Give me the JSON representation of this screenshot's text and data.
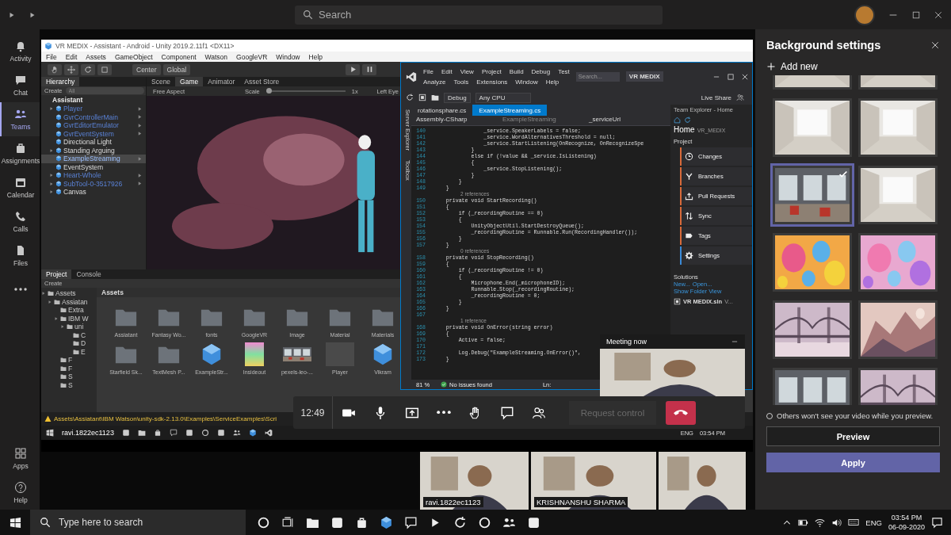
{
  "title_bar": {
    "search_placeholder": "Search"
  },
  "rail": [
    {
      "label": "Activity",
      "kind": "bell",
      "selected": false
    },
    {
      "label": "Chat",
      "kind": "chat",
      "selected": false
    },
    {
      "label": "Teams",
      "kind": "teams",
      "selected": true
    },
    {
      "label": "Assignments",
      "kind": "bag",
      "selected": false
    },
    {
      "label": "Calendar",
      "kind": "calendar",
      "selected": false
    },
    {
      "label": "Calls",
      "kind": "phone",
      "selected": false
    },
    {
      "label": "Files",
      "kind": "file",
      "selected": false
    },
    {
      "kind": "more",
      "selected": false
    }
  ],
  "rail_bottom": [
    {
      "label": "Apps",
      "kind": "apps"
    },
    {
      "label": "Help",
      "kind": "help"
    }
  ],
  "shared_screen": {
    "unity": {
      "title": "VR MEDIX - Assistant - Android - Unity 2019.2.11f1 <DX11>",
      "menu": [
        "File",
        "Edit",
        "Assets",
        "GameObject",
        "Component",
        "Watson",
        "GoogleVR",
        "Window",
        "Help"
      ],
      "pivot": [
        "Center",
        "Global"
      ],
      "hierarchy": {
        "tab": "Hierarchy",
        "create": "Create",
        "search_placeholder": "All",
        "scene": "Assistant",
        "items": [
          {
            "label": "Player",
            "prefab": true,
            "expandable": true,
            "selected": false
          },
          {
            "label": "GvrControllerMain",
            "prefab": true,
            "expandable": false,
            "selected": false
          },
          {
            "label": "GvrEditorEmulator",
            "prefab": true,
            "expandable": false,
            "selected": false
          },
          {
            "label": "GvrEventSystem",
            "prefab": true,
            "expandable": false,
            "selected": false
          },
          {
            "label": "Directional Light",
            "prefab": false,
            "expandable": false,
            "selected": false
          },
          {
            "label": "Standing Arguing",
            "prefab": false,
            "expandable": true,
            "selected": false
          },
          {
            "label": "ExampleStreaming",
            "prefab": true,
            "expandable": false,
            "selected": true
          },
          {
            "label": "EventSystem",
            "prefab": false,
            "expandable": false,
            "selected": false
          },
          {
            "label": "Heart-Whole",
            "prefab": true,
            "expandable": true,
            "selected": false
          },
          {
            "label": "SubTool-0-3517926",
            "prefab": true,
            "expandable": true,
            "selected": false
          },
          {
            "label": "Canvas",
            "prefab": false,
            "expandable": true,
            "selected": false
          }
        ]
      },
      "view_tabs": [
        {
          "label": "Scene",
          "selected": false
        },
        {
          "label": "Game",
          "selected": true
        },
        {
          "label": "Animator",
          "selected": false
        },
        {
          "label": "Asset Store",
          "selected": false
        }
      ],
      "game_bar": {
        "aspect": "Free Aspect",
        "scale_label": "Scale",
        "scale_slider": {
          "level": 0
        },
        "scale_value": "1x",
        "eye": "Left Eye"
      },
      "project": {
        "tabs": [
          {
            "label": "Project",
            "selected": true
          },
          {
            "label": "Console",
            "selected": false
          }
        ],
        "create": "Create",
        "tree": [
          {
            "label": "Assets",
            "children": [
              {
                "label": "Assiatan",
                "children": [
                  {
                    "label": "Extra"
                  },
                  {
                    "label": "IBM W",
                    "children": [
                      {
                        "label": "uni",
                        "children": [
                          {
                            "label": "C"
                          },
                          {
                            "label": "D"
                          },
                          {
                            "label": "E"
                          }
                        ]
                      }
                    ]
                  },
                  {
                    "label": "F"
                  },
                  {
                    "label": "F"
                  },
                  {
                    "label": "S"
                  },
                  {
                    "label": "S"
                  }
                ]
              }
            ]
          }
        ],
        "folder_title": "Assets",
        "assets": [
          {
            "name": "Assiatant",
            "kind": "folder"
          },
          {
            "name": "Fantasy Wo...",
            "kind": "folder"
          },
          {
            "name": "fonts",
            "kind": "folder"
          },
          {
            "name": "GoogleVR",
            "kind": "folder"
          },
          {
            "name": "Image",
            "kind": "folder"
          },
          {
            "name": "Material",
            "kind": "folder"
          },
          {
            "name": "Materials",
            "kind": "folder"
          },
          {
            "name": "Starfield Sk...",
            "kind": "folder"
          },
          {
            "name": "TextMesh P...",
            "kind": "folder"
          },
          {
            "name": "ExampleStr...",
            "kind": "prefab"
          },
          {
            "name": "Insideout",
            "kind": "shader"
          },
          {
            "name": "pexels-leo-..."
          },
          {
            "name": "Player",
            "kind": "material"
          },
          {
            "name": "Vikram",
            "kind": "prefab"
          }
        ]
      },
      "status_warning": "Assets\\Assiatant\\IBM Watson\\unity-sdk-2.13.0\\Examples\\ServiceExamples\\Scri"
    },
    "visual_studio": {
      "menu_rows": [
        [
          "File",
          "Edit",
          "View",
          "Project",
          "Build",
          "Debug",
          "Test"
        ],
        [
          "Analyze",
          "Tools",
          "Extensions",
          "Window",
          "Help"
        ]
      ],
      "search_placeholder": "Search...",
      "solution_badge": "VR MEDIX",
      "configuration": "Debug",
      "platform": "Any CPU",
      "live_share": "Live Share",
      "side_tabs": [
        "Server Explorer",
        "Toolbox"
      ],
      "doc_tabs": [
        {
          "label": "rotationsphare.cs",
          "selected": false
        },
        {
          "label": "ExampleStreaming.cs",
          "selected": true
        }
      ],
      "nav": [
        "Assembly-CSharp",
        "ExampleStreaming",
        "_serviceUrl"
      ],
      "code": [
        {
          "kind": "code",
          "no": "140",
          "text": "                _service.SpeakerLabels = false;"
        },
        {
          "kind": "code",
          "no": "141",
          "text": "                _service.WordAlternativesThreshold = null;"
        },
        {
          "kind": "code",
          "no": "142",
          "text": "                _service.StartListening(OnRecognize, OnRecognizeSpe"
        },
        {
          "kind": "code",
          "no": "143",
          "text": "            }"
        },
        {
          "kind": "code",
          "no": "144",
          "text": "            else if (!value && _service.IsListening)"
        },
        {
          "kind": "code",
          "no": "145",
          "text": "            {"
        },
        {
          "kind": "code",
          "no": "146",
          "text": "                _service.StopListening();"
        },
        {
          "kind": "code",
          "no": "147",
          "text": "            }"
        },
        {
          "kind": "code",
          "no": "148",
          "text": "        }"
        },
        {
          "kind": "code",
          "no": "149",
          "text": "    }"
        },
        {
          "kind": "lens",
          "text": "2 references"
        },
        {
          "kind": "code",
          "no": "150",
          "text": "    private void StartRecording()"
        },
        {
          "kind": "code",
          "no": "151",
          "text": "    {"
        },
        {
          "kind": "code",
          "no": "152",
          "text": "        if (_recordingRoutine == 0)"
        },
        {
          "kind": "code",
          "no": "153",
          "text": "        {"
        },
        {
          "kind": "code",
          "no": "154",
          "text": "            UnityObjectUtil.StartDestroyQueue();"
        },
        {
          "kind": "code",
          "no": "155",
          "text": "            _recordingRoutine = Runnable.Run(RecordingHandler());"
        },
        {
          "kind": "code",
          "no": "156",
          "text": "        }"
        },
        {
          "kind": "code",
          "no": "157",
          "text": "    }"
        },
        {
          "kind": "lens",
          "text": "0 references"
        },
        {
          "kind": "code",
          "no": "158",
          "text": "    private void StopRecording()"
        },
        {
          "kind": "code",
          "no": "159",
          "text": "    {"
        },
        {
          "kind": "code",
          "no": "160",
          "text": "        if (_recordingRoutine != 0)"
        },
        {
          "kind": "code",
          "no": "161",
          "text": "        {"
        },
        {
          "kind": "code",
          "no": "162",
          "text": "            Microphone.End(_microphoneID);"
        },
        {
          "kind": "code",
          "no": "163",
          "text": "            Runnable.Stop(_recordingRoutine);"
        },
        {
          "kind": "code",
          "no": "164",
          "text": "            _recordingRoutine = 0;"
        },
        {
          "kind": "code",
          "no": "165",
          "text": "        }"
        },
        {
          "kind": "code",
          "no": "166",
          "text": "    }"
        },
        {
          "kind": "code",
          "no": "167"
        },
        {
          "kind": "lens",
          "text": "1 reference"
        },
        {
          "kind": "code",
          "no": "168",
          "text": "    private void OnError(string error)"
        },
        {
          "kind": "code",
          "no": "169",
          "text": "    {"
        },
        {
          "kind": "code",
          "no": "170",
          "text": "        Active = false;"
        },
        {
          "kind": "code",
          "no": "171"
        },
        {
          "kind": "code",
          "no": "172",
          "text": "        Log.Debug(\"ExampleStreaming.OnError()\","
        },
        {
          "kind": "code",
          "no": "173",
          "text": "    }"
        }
      ],
      "status": {
        "zoom": "81 %",
        "issues": "No issues found",
        "position": "Ln:"
      },
      "team_explorer": {
        "title": "Team Explorer - Home",
        "home": "Home",
        "repo": "VR_MEDIX",
        "project": "Project",
        "items": [
          {
            "label": "Changes",
            "kind": "clock"
          },
          {
            "label": "Branches",
            "kind": "branch"
          },
          {
            "label": "Pull Requests",
            "kind": "upload"
          },
          {
            "label": "Sync",
            "kind": "sync"
          },
          {
            "label": "Tags",
            "kind": "tag"
          },
          {
            "label": "Settings",
            "kind": "gear"
          }
        ],
        "solutions": "Solutions",
        "links": [
          "New...",
          "Open...",
          "Show Folder View"
        ],
        "solution": "VR MEDIX.sln",
        "solution_more": "V..."
      }
    },
    "taskbar": {
      "language": "ENG",
      "time": "03:54 PM"
    },
    "presenter": "ravi.1822ec1123"
  },
  "mini_window": {
    "title": "Meeting now"
  },
  "meeting_controls": {
    "timer": "12:49",
    "request_control": {
      "label": "Request control",
      "disabled": true
    }
  },
  "participants": [
    {
      "name": "ravi.1822ec1123"
    },
    {
      "name": "KRISHNANSHU SHARMA"
    },
    {
      "kind": "picture"
    }
  ],
  "background_settings": {
    "title": "Background settings",
    "add_new": "Add new",
    "backgrounds": [
      {
        "selected": false
      },
      {
        "selected": false
      },
      {
        "selected": false
      },
      {
        "selected": false
      },
      {
        "selected": true
      },
      {
        "selected": false
      },
      {
        "selected": false
      },
      {
        "selected": false
      },
      {
        "selected": false
      },
      {
        "selected": false
      },
      {
        "selected": false
      },
      {
        "selected": false
      }
    ],
    "notice": "Others won't see your video while you preview.",
    "preview": "Preview",
    "apply": "Apply"
  },
  "taskbar": {
    "search_placeholder": "Type here to search",
    "language": "ENG",
    "time": "03:54 PM",
    "date": "06-09-2020"
  }
}
